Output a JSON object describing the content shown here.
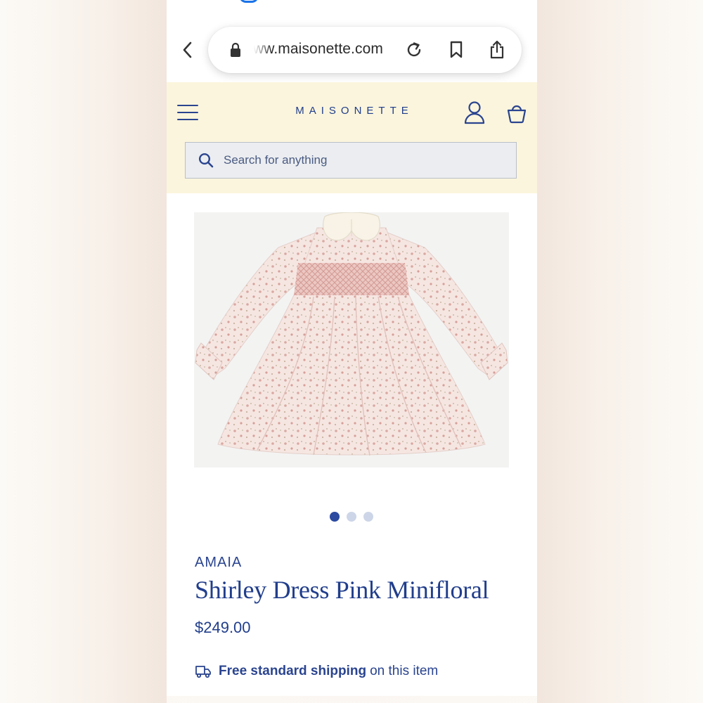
{
  "browser": {
    "url": "ww.maisonette.com"
  },
  "header": {
    "brand": "MAISONETTE",
    "search_placeholder": "Search for anything"
  },
  "product": {
    "brand": "AMAIA",
    "title": "Shirley Dress Pink Minifloral",
    "price": "$249.00",
    "image_dots": 3,
    "active_dot": 0,
    "shipping": {
      "strong": "Free standard shipping",
      "rest": "on this item"
    }
  },
  "colors": {
    "brand_navy": "#213e8c",
    "header_bg": "#fbf5dd",
    "dot_active": "#2b4aa0",
    "dot_inactive": "#cdd6e8"
  },
  "icons": [
    "back-icon",
    "lock-icon",
    "reload-icon",
    "bookmark-icon",
    "share-icon",
    "menu-icon",
    "account-icon",
    "bag-icon",
    "search-icon",
    "truck-icon"
  ]
}
